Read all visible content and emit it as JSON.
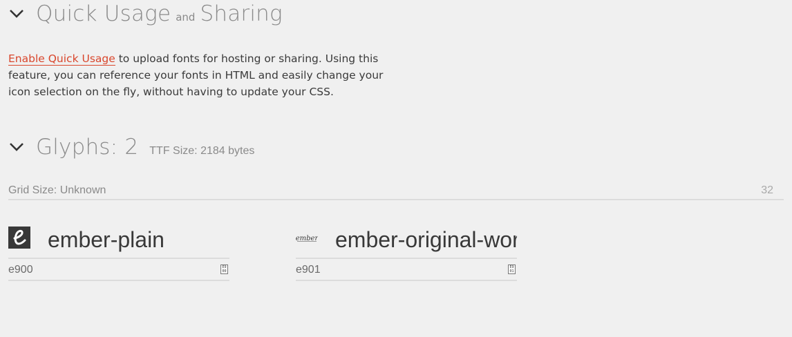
{
  "quick_usage": {
    "title_part1": "Quick Usage",
    "title_and": "and",
    "title_part2": "Sharing",
    "link_text": "Enable Quick Usage",
    "description": " to upload fonts for hosting or sharing. Using this feature, you can reference your fonts in HTML and easily change your icon selection on the fly, without having to update your CSS."
  },
  "glyphs_section": {
    "title": "Glyphs: 2",
    "ttf_size": "TTF Size: 2184 bytes",
    "grid_label": "Grid Size: Unknown",
    "grid_size_value": "32"
  },
  "glyphs": [
    {
      "name": "ember-plain",
      "code": "e900",
      "icon": "ember-plain-icon",
      "copy_glyph": "E9\n00"
    },
    {
      "name": "ember-original-wordmark",
      "code": "e901",
      "icon": "ember-wordmark-icon",
      "icon_text": "ember",
      "copy_glyph": "E9\n01"
    }
  ],
  "colors": {
    "background": "#f0f0f0",
    "link": "#d9462c",
    "heading": "#8a8a8a",
    "text": "#383838"
  }
}
